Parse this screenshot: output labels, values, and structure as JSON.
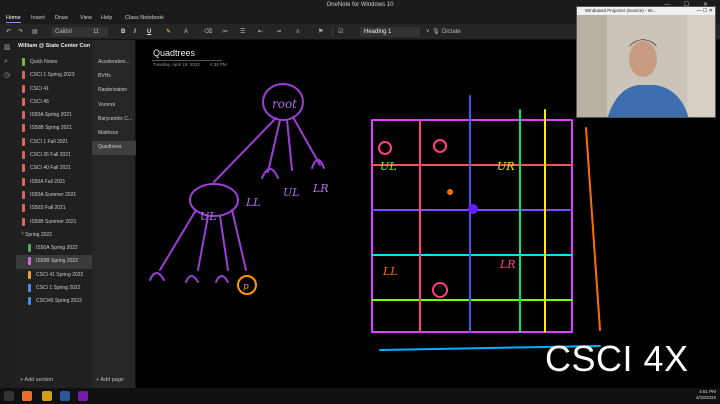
{
  "window": {
    "title": "OneNote for Windows 10",
    "controls": "— ☐ ✕"
  },
  "ribbon_tabs": [
    "Home",
    "Insert",
    "Draw",
    "View",
    "Help",
    "Class Notebook"
  ],
  "ribbon": {
    "undo_icon": "undo-icon",
    "font": "Calibri",
    "size": "11",
    "bold": "B",
    "italic": "I",
    "underline": "U",
    "style": "Heading 1",
    "dictate": "Dictate"
  },
  "notebook": {
    "name": "William @ State Center Commu...",
    "sections": [
      {
        "label": "Quick Notes",
        "color": "#7cb342"
      },
      {
        "label": "CSCI 1 Spring 2023",
        "color": "#e06666"
      },
      {
        "label": "CSCI 41",
        "color": "#e06666"
      },
      {
        "label": "CSCI 45",
        "color": "#e06666"
      },
      {
        "label": "IS50A Spring 2021",
        "color": "#e06666"
      },
      {
        "label": "IS50B Spring 2021",
        "color": "#e06666"
      },
      {
        "label": "CSCI 1 Fall 2021",
        "color": "#e06666"
      },
      {
        "label": "CSCI 26 Fall 2021",
        "color": "#e06666"
      },
      {
        "label": "CSCI 40 Fall 2021",
        "color": "#e06666"
      },
      {
        "label": "IS50A Fall 2021",
        "color": "#e06666"
      },
      {
        "label": "IS50A Summer 2021",
        "color": "#e06666"
      },
      {
        "label": "IS50S Fall 2021",
        "color": "#e06666"
      },
      {
        "label": "IS50B Summer 2021",
        "color": "#e06666"
      }
    ],
    "group": {
      "label": "Spring 2022",
      "chevron": "˅"
    },
    "group_sections": [
      {
        "label": "IS50A Spring 2022",
        "color": "#4caf50",
        "selected": false
      },
      {
        "label": "IS50B Spring 2022",
        "color": "#d36bd3",
        "selected": true
      },
      {
        "label": "CSCI 41 Spring 2022",
        "color": "#e6a23c",
        "selected": false
      },
      {
        "label": "CSCI 1 Spring 2022",
        "color": "#3f8ee0",
        "selected": false
      },
      {
        "label": "CSCI45 Spring 2022",
        "color": "#3f8ee0",
        "selected": false
      }
    ],
    "add_section": "+ Add section"
  },
  "pages": {
    "items": [
      {
        "label": "Acceleration...",
        "selected": false
      },
      {
        "label": "BVHs",
        "selected": false
      },
      {
        "label": "Rasterization",
        "selected": false
      },
      {
        "label": "Voronoi",
        "selected": false
      },
      {
        "label": "Barycentric C...",
        "selected": false
      },
      {
        "label": "Mattrices",
        "selected": false
      },
      {
        "label": "Quadtrees",
        "selected": true
      }
    ],
    "add_page": "+ Add page"
  },
  "page": {
    "title": "Quadtrees",
    "date": "Tuesday, April 19, 2022",
    "time": "4:34 PM"
  },
  "ink_labels": {
    "root": "root",
    "child_1": "LL",
    "child_2": "UL",
    "child_3": "LR",
    "node": "UL",
    "leaf_p": "p",
    "grid_cells": [
      "UL",
      "UR",
      "LL",
      "LR"
    ]
  },
  "overlay_text": "CSCI 4X",
  "webcam": {
    "title": "Windowed Projector (Source) - W...",
    "controls": "— ☐ ✕"
  },
  "taskbar": {
    "time": "4:51 PM",
    "date": "4/19/2022"
  }
}
